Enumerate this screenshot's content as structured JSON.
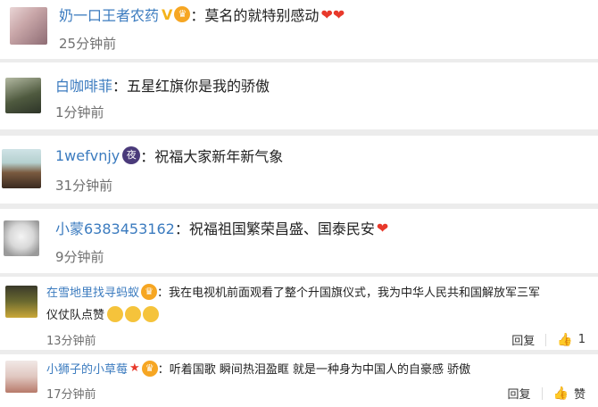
{
  "comments": [
    {
      "username": "奶一口王者农药",
      "badge_v": "V",
      "badge_crown": "👑",
      "text": "莫名的就特别感动",
      "hearts": "❤❤",
      "time": "25分钟前"
    },
    {
      "username": "白咖啡菲",
      "text": "五星红旗你是我的骄傲",
      "time": "1分钟前"
    },
    {
      "username": "1wefvnjy",
      "badge_night": "夜",
      "text": "祝福大家新年新气象",
      "time": "31分钟前"
    },
    {
      "username": "小蒙6383453162",
      "text": "祝福祖国繁荣昌盛、国泰民安",
      "hearts": "❤",
      "time": "9分钟前"
    },
    {
      "username": "在雪地里找寻蚂蚁",
      "badge_crown": "👑",
      "text_line1": "我在电视机前面观看了整个升国旗仪式，我为中华人民共和国解放军三军",
      "text_line2": "仪仗队点赞",
      "time": "13分钟前",
      "reply_label": "回复",
      "like_count": "1"
    },
    {
      "username": "小狮子的小草莓",
      "badge_star": "★",
      "badge_crown": "👑",
      "text": "听着国歌 瞬间热泪盈眶 就是一种身为中国人的自豪感 骄傲",
      "time": "17分钟前",
      "reply_label": "回复",
      "like_label": "赞"
    }
  ],
  "colors": {
    "username_blue": "#3b7bbf",
    "background": "#ececec",
    "card": "#ffffff"
  }
}
